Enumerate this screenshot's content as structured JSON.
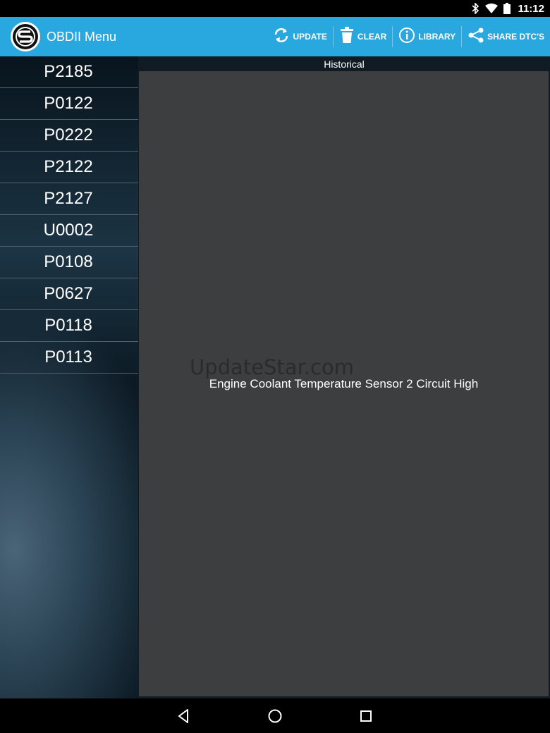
{
  "status_bar": {
    "time": "11:12",
    "icons": [
      "bluetooth-icon",
      "wifi-icon",
      "battery-icon"
    ]
  },
  "action_bar": {
    "title": "OBDII Menu",
    "logo_icon": "s-logo-icon",
    "actions": [
      {
        "label": "UPDATE",
        "icon": "refresh-icon"
      },
      {
        "label": "CLEAR",
        "icon": "trash-icon"
      },
      {
        "label": "LIBRARY",
        "icon": "info-icon"
      },
      {
        "label": "SHARE DTC'S",
        "icon": "share-icon"
      }
    ]
  },
  "dtc_list": {
    "codes": [
      "P2185",
      "P0122",
      "P0222",
      "P2122",
      "P2127",
      "U0002",
      "P0108",
      "P0627",
      "P0118",
      "P0113"
    ]
  },
  "main": {
    "section_header": "Historical",
    "watermark": "UpdateStar.com",
    "description": "Engine Coolant Temperature Sensor 2 Circuit High"
  },
  "nav_bar": {
    "icons": [
      "back-icon",
      "home-icon",
      "recents-icon"
    ]
  },
  "colors": {
    "action_bar": "#29a8e0",
    "panel": "#3d3e40",
    "divider": "#4a6272"
  }
}
